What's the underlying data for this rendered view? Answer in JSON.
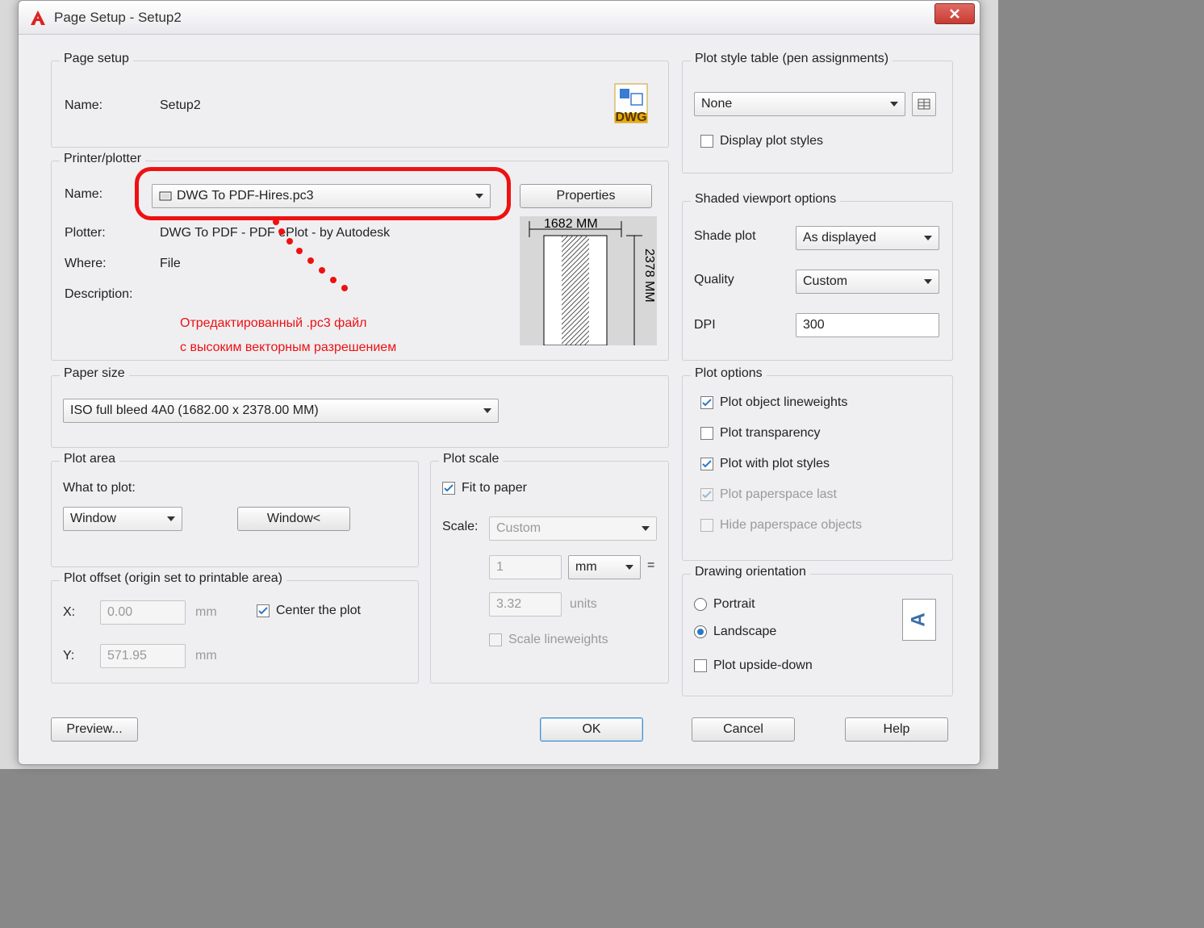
{
  "title": "Page Setup - Setup2",
  "pageSetup": {
    "group": "Page setup",
    "nameLabel": "Name:",
    "name": "Setup2"
  },
  "printer": {
    "group": "Printer/plotter",
    "nameLabel": "Name:",
    "name": "DWG To PDF-Hires.pc3",
    "propertiesBtn": "Properties",
    "plotterLabel": "Plotter:",
    "plotter": "DWG To PDF - PDF ePlot - by Autodesk",
    "whereLabel": "Where:",
    "where": "File",
    "descriptionLabel": "Description:",
    "preview": {
      "widthText": "1682 MM",
      "heightText": "2378 MM"
    }
  },
  "paperSize": {
    "group": "Paper size",
    "value": "ISO full bleed 4A0 (1682.00 x 2378.00 MM)"
  },
  "plotArea": {
    "group": "Plot area",
    "whatLabel": "What to plot:",
    "value": "Window",
    "windowBtn": "Window<"
  },
  "plotOffset": {
    "group": "Plot offset (origin set to printable area)",
    "xLabel": "X:",
    "xValue": "0.00",
    "xUnit": "mm",
    "yLabel": "Y:",
    "yValue": "571.95",
    "yUnit": "mm",
    "centerLabel": "Center the plot"
  },
  "plotScale": {
    "group": "Plot scale",
    "fitLabel": "Fit to paper",
    "scaleLabel": "Scale:",
    "scaleValue": "Custom",
    "numerator": "1",
    "unit": "mm",
    "denominator": "3.32",
    "unitsLabel": "units",
    "scaleLwLabel": "Scale lineweights"
  },
  "plotStyle": {
    "group": "Plot style table (pen assignments)",
    "value": "None",
    "displayLabel": "Display plot styles"
  },
  "shadedViewport": {
    "group": "Shaded viewport options",
    "shadeLabel": "Shade plot",
    "shadeValue": "As displayed",
    "qualityLabel": "Quality",
    "qualityValue": "Custom",
    "dpiLabel": "DPI",
    "dpiValue": "300"
  },
  "plotOptions": {
    "group": "Plot options",
    "lineweights": "Plot object lineweights",
    "transparency": "Plot transparency",
    "plotStyles": "Plot with plot styles",
    "paperspaceLast": "Plot paperspace last",
    "hidePaperspace": "Hide paperspace objects"
  },
  "orientation": {
    "group": "Drawing orientation",
    "portrait": "Portrait",
    "landscape": "Landscape",
    "upsideDown": "Plot upside-down"
  },
  "buttons": {
    "preview": "Preview...",
    "ok": "OK",
    "cancel": "Cancel",
    "help": "Help"
  },
  "annotation": {
    "line1": "Отредактированный .pc3 файл",
    "line2": "с высоким векторным разрешением"
  }
}
